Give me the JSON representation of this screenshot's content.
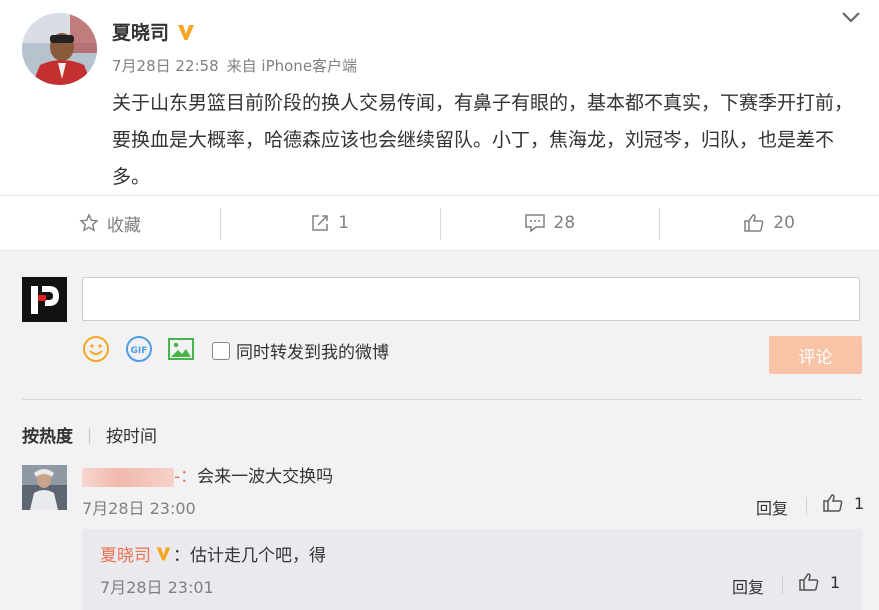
{
  "post": {
    "author": "夏晓司",
    "verified_icon": "verified-v-badge",
    "time": "7月28日 22:58",
    "source": "来自 iPhone客户端",
    "text": "关于山东男篮目前阶段的换人交易传闻，有鼻子有眼的，基本都不真实，下赛季开打前，要换血是大概率，哈德森应该也会继续留队。小丁，焦海龙，刘冠岑，归队，也是差不多。"
  },
  "actions": {
    "favorite_label": "收藏",
    "share_count": "1",
    "comment_count": "28",
    "like_count": "20"
  },
  "composer": {
    "input_value": "",
    "forward_label": "同时转发到我的微博",
    "submit_label": "评论"
  },
  "sort": {
    "hot_label": "按热度",
    "time_label": "按时间"
  },
  "comments": [
    {
      "user_suffix": "-：",
      "text": "会来一波大交换吗",
      "time": "7月28日 23:00",
      "reply_label": "回复",
      "likes": "1",
      "replies": [
        {
          "user": "夏晓司",
          "text": "：估计走几个吧，得",
          "time": "7月28日 23:01",
          "reply_label": "回复",
          "likes": "1"
        }
      ]
    }
  ],
  "colors": {
    "username": "#eb7350",
    "verified": "#f6a623",
    "submit_bg": "#f9c4a6",
    "comment_bg": "#f2f2f5"
  }
}
